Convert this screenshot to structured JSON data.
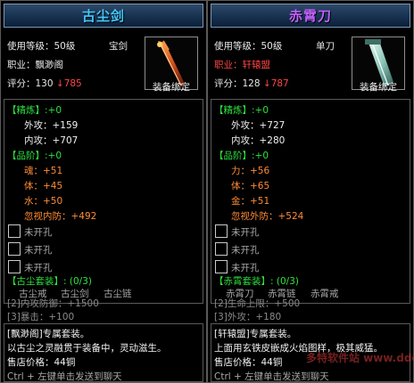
{
  "left": {
    "title": "古尘剑",
    "level": "使用等级：50级",
    "type": "宝剑",
    "school_label": "职业：",
    "school": "飘渺阁",
    "score_label": "评分：",
    "score": "130",
    "score_delta": "↓785",
    "bind": "装备绑定",
    "refine_header": "【精炼】:+0",
    "outer_atk": "外攻：+159",
    "inner_atk": "内攻：+707",
    "rank_header": "【品阶】:+0",
    "rank_stats": [
      "魂：+51",
      "体：+45",
      "水：+50"
    ],
    "special": "忽视内防：+492",
    "sockets": [
      "未开孔",
      "未开孔",
      "未开孔"
    ],
    "set_header": "【古尘套装】: (0/3)",
    "set_items": [
      "古尘戒",
      "古尘剑",
      "古尘链"
    ],
    "set_bonus": [
      "[2]内攻防御：+1500",
      "[3]暴击：+100"
    ],
    "desc_tag": "[飘渺阁]专属套装。",
    "desc_line": "以古尘之灵融贯于装备中，灵动滋生。",
    "price": "售店价格：44铜",
    "hint": "Ctrl + 左键单击发送到聊天"
  },
  "right": {
    "title": "赤霄刀",
    "level": "使用等级：50级",
    "type": "单刀",
    "school_label": "职业：",
    "school": "轩辕盟",
    "score_label": "评分：",
    "score": "128",
    "score_delta": "↓787",
    "bind": "装备绑定",
    "refine_header": "【精炼】:+0",
    "outer_atk": "外攻：+727",
    "inner_atk": "内攻：+280",
    "rank_header": "【品阶】:+0",
    "rank_stats": [
      "力：+56",
      "体：+65",
      "金：+51"
    ],
    "special": "忽视外防：+524",
    "sockets": [
      "未开孔",
      "未开孔",
      "未开孔"
    ],
    "set_header": "【赤霄套装】: (0/3)",
    "set_items": [
      "赤霄刀",
      "赤霄链",
      "赤霄戒"
    ],
    "set_bonus": [
      "[2]生命上限：+500",
      "[3]外攻：+180"
    ],
    "desc_tag": "[轩辕盟]专属套装。",
    "desc_line": "上面用玄铁皮嵌成火焰图样，极其威猛。",
    "price": "售店价格：44铜",
    "hint": "Ctrl + 左键单击发送到聊天"
  },
  "watermark": "多特软件站 www.ddooo.com"
}
